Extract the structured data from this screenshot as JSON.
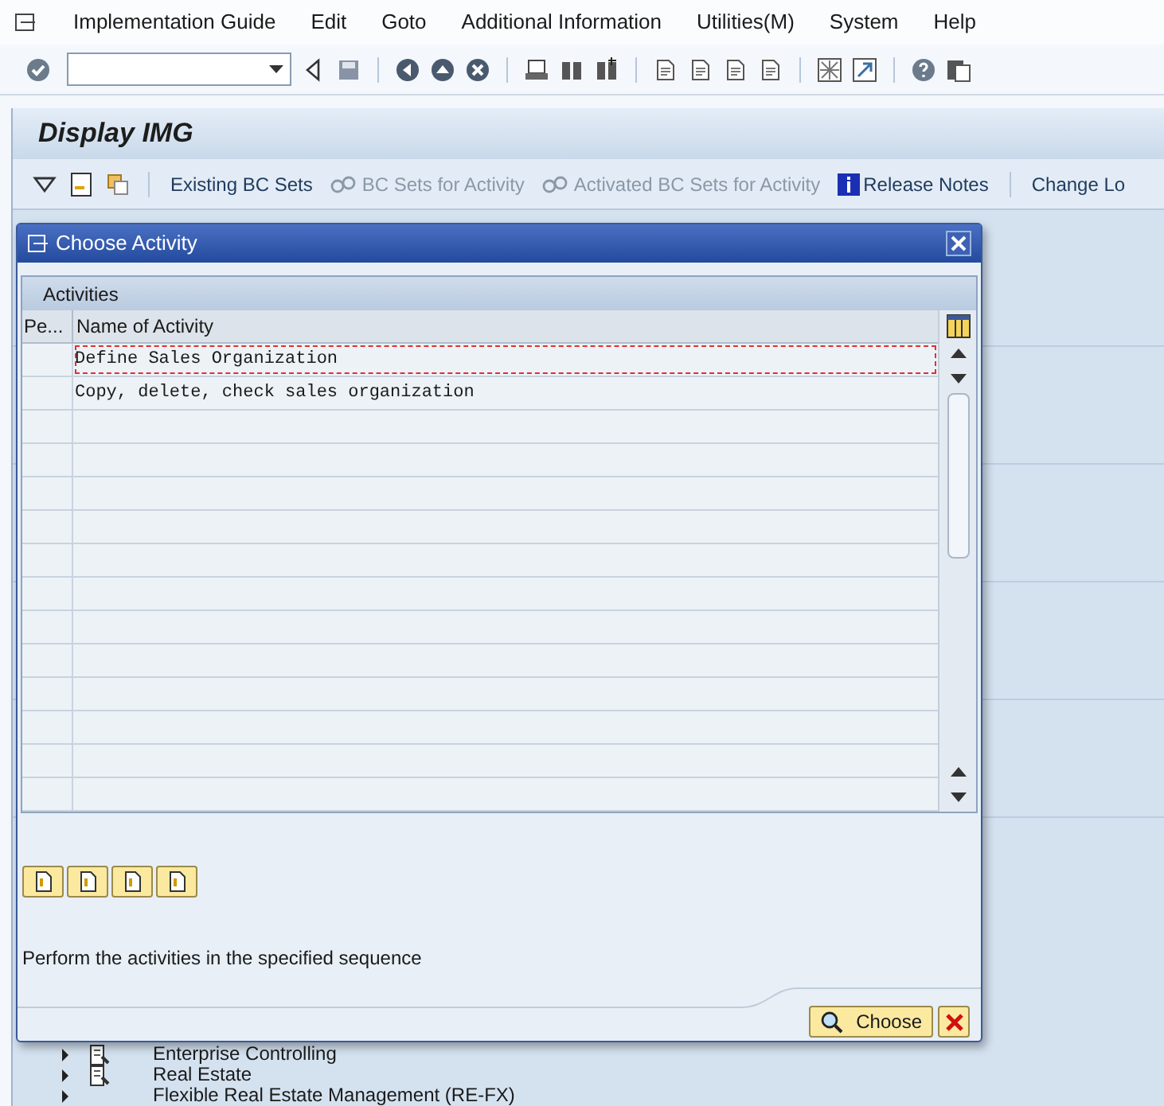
{
  "menu": [
    {
      "label": "Implementation Guide"
    },
    {
      "label": "Edit"
    },
    {
      "label": "Goto"
    },
    {
      "label": "Additional Information"
    },
    {
      "label": "Utilities(M)"
    },
    {
      "label": "System"
    },
    {
      "label": "Help"
    }
  ],
  "screen_title": "Display IMG",
  "app_toolbar": [
    {
      "label": "Existing BC Sets",
      "disabled": false,
      "kind": "text"
    },
    {
      "label": "BC Sets for Activity",
      "disabled": true,
      "kind": "bcset"
    },
    {
      "label": "Activated BC Sets for Activity",
      "disabled": true,
      "kind": "bcset"
    },
    {
      "label": "Release Notes",
      "disabled": false,
      "kind": "info"
    },
    {
      "label": "Change Lo",
      "disabled": false,
      "kind": "text"
    }
  ],
  "tree": [
    {
      "label": "Enterprise Controlling"
    },
    {
      "label": "Real Estate"
    },
    {
      "label": "Flexible Real Estate Management (RE-FX)"
    }
  ],
  "dialog": {
    "title": "Choose Activity",
    "table_title": "Activities",
    "columns": [
      "Pe...",
      "Name of Activity"
    ],
    "rows": [
      {
        "name": "Define Sales Organization",
        "selected": true
      },
      {
        "name": "Copy, delete, check sales organization",
        "selected": false
      }
    ],
    "message": "Perform the activities in the specified sequence",
    "buttons": [
      {
        "label": "Choose",
        "kind": "choose"
      },
      {
        "kind": "cancel"
      }
    ]
  }
}
